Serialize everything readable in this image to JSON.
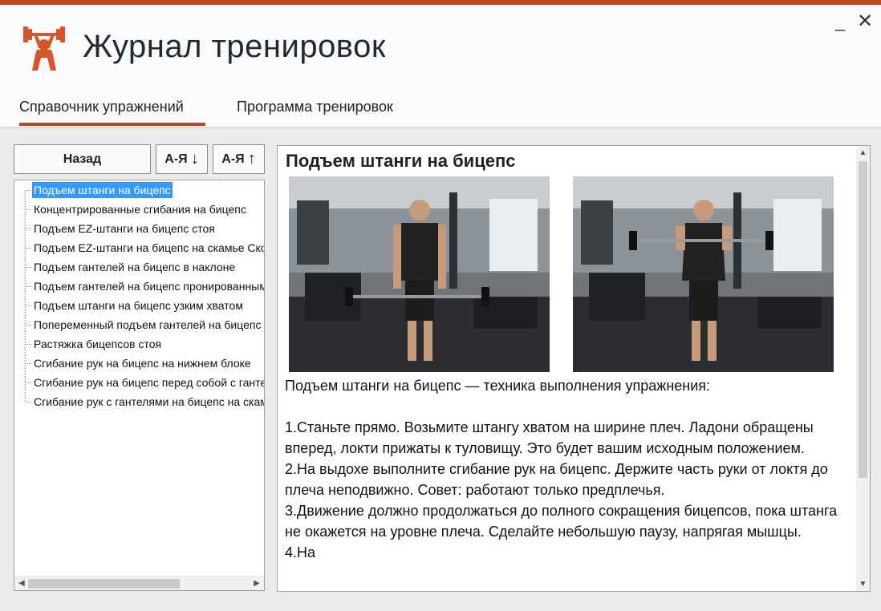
{
  "app": {
    "title": "Журнал тренировок",
    "accent_color": "#c0461e",
    "logo_icon": "weightlifter-icon"
  },
  "window_controls": {
    "minimize": "_",
    "close": "✕"
  },
  "tabs": [
    {
      "label": "Справочник упражнений",
      "active": true
    },
    {
      "label": "Программа тренировок",
      "active": false
    }
  ],
  "toolbar": {
    "back_label": "Назад",
    "sort_asc_label": "А-Я",
    "sort_asc_arrow": "↓",
    "sort_desc_label": "А-Я",
    "sort_desc_arrow": "↑"
  },
  "exercise_list": [
    {
      "label": "Подъем штанги на бицепс",
      "selected": true
    },
    {
      "label": "Концентрированные сгибания на бицепс",
      "selected": false
    },
    {
      "label": "Подъем EZ-штанги на бицепс стоя",
      "selected": false
    },
    {
      "label": "Подъем EZ-штанги на бицепс на скамье Скотта",
      "selected": false
    },
    {
      "label": "Подъем гантелей на бицепс в наклоне",
      "selected": false
    },
    {
      "label": "Подъем гантелей на бицепс пронированным хватом",
      "selected": false
    },
    {
      "label": "Подъем штанги на бицепс узким хватом",
      "selected": false
    },
    {
      "label": "Попеременный подъем гантелей на бицепс",
      "selected": false
    },
    {
      "label": "Растяжка бицепсов стоя",
      "selected": false
    },
    {
      "label": "Сгибание рук на бицепс на нижнем блоке",
      "selected": false
    },
    {
      "label": "Сгибание рук на бицепс перед собой с гантелями",
      "selected": false
    },
    {
      "label": "Сгибание рук с гантелями на бицепс на скамье",
      "selected": false
    }
  ],
  "detail": {
    "title": "Подъем штанги на бицепс",
    "subtitle": "Подъем штанги на бицепс — техника выполнения упражнения:",
    "steps": [
      "1.Станьте прямо. Возьмите штангу хватом на ширине плеч. Ладони обращены вперед, локти прижаты к туловищу. Это будет вашим исходным положением.",
      "2.На выдохе выполните сгибание рук на бицепс. Держите часть руки от локтя до плеча неподвижно. Совет: работают только предплечья.",
      "3.Движение должно продолжаться до полного сокращения бицепсов, пока штанга не окажется на уровне плеча. Сделайте небольшую паузу, напрягая мышцы.",
      "4.На"
    ]
  }
}
